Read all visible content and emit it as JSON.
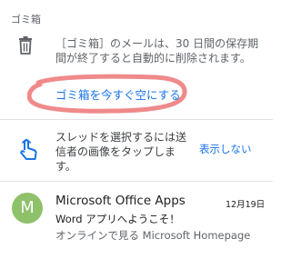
{
  "header": {
    "folder_label": "ゴミ箱"
  },
  "trash_notice": {
    "text": "［ゴミ箱］のメールは、30 日間の保存期間が終了すると自動的に削除されます。",
    "empty_button": "ゴミ箱を今すぐ空にする",
    "icon": "trash-icon",
    "highlight_color": "#f08a8a"
  },
  "tip": {
    "text": "スレッドを選択するには送信者の画像をタップします。",
    "dismiss_button": "表示しない",
    "icon": "touch-icon"
  },
  "emails": [
    {
      "avatar_letter": "M",
      "avatar_color": "#8ec16a",
      "sender": "Microsoft Office Apps",
      "date": "12月19日",
      "subject": "Word アプリへようこそ！",
      "preview": "オンラインで見る Microsoft Homepage"
    }
  ],
  "colors": {
    "accent": "#1a73e8"
  }
}
